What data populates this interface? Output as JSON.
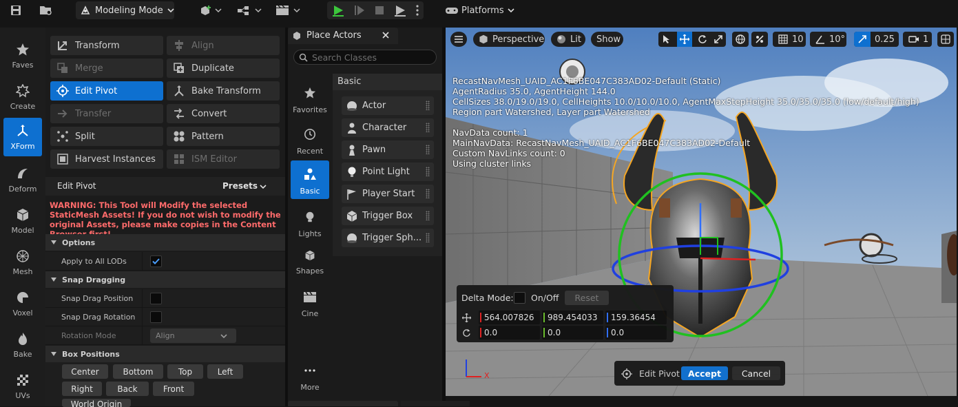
{
  "toolbar": {
    "mode_label": "Modeling Mode",
    "platforms_label": "Platforms"
  },
  "categories": [
    {
      "label": "Faves",
      "icon": "star-icon"
    },
    {
      "label": "Create",
      "icon": "create-icon"
    },
    {
      "label": "XForm",
      "icon": "xform-icon",
      "active": true
    },
    {
      "label": "Deform",
      "icon": "deform-icon"
    },
    {
      "label": "Model",
      "icon": "model-icon"
    },
    {
      "label": "Mesh",
      "icon": "mesh-icon"
    },
    {
      "label": "Voxel",
      "icon": "voxel-icon"
    },
    {
      "label": "Bake",
      "icon": "bake-icon"
    },
    {
      "label": "UVs",
      "icon": "uvs-icon"
    }
  ],
  "tools": {
    "transform": "Transform",
    "align": "Align",
    "merge": "Merge",
    "duplicate": "Duplicate",
    "edit_pivot": "Edit Pivot",
    "bake_transform": "Bake Transform",
    "transfer": "Transfer",
    "convert": "Convert",
    "split": "Split",
    "pattern": "Pattern",
    "harvest_instances": "Harvest Instances",
    "ism_editor": "ISM Editor"
  },
  "details": {
    "title": "Edit Pivot",
    "presets": "Presets",
    "warning": "WARNING: This Tool will Modify the selected StaticMesh Assets! If you do not wish to modify the original Assets, please make copies in the Content Browser first!",
    "options_header": "Options",
    "apply_all_lods": "Apply to All LODs",
    "apply_all_lods_checked": true,
    "snap_header": "Snap Dragging",
    "snap_drag_position": "Snap Drag Position",
    "snap_drag_rotation": "Snap Drag Rotation",
    "rotation_mode": "Rotation Mode",
    "rotation_mode_value": "Align",
    "box_header": "Box Positions",
    "box_buttons": [
      "Center",
      "Bottom",
      "Top",
      "Left",
      "Right",
      "Back",
      "Front"
    ],
    "world_origin": "World Origin"
  },
  "place_actors": {
    "tab_label": "Place Actors",
    "search_placeholder": "Search Classes",
    "section": "Basic",
    "categories": [
      {
        "label": "Favorites",
        "icon": "star-icon"
      },
      {
        "label": "Recent",
        "icon": "clock-icon"
      },
      {
        "label": "Basic",
        "icon": "basic-shapes-icon",
        "active": true
      },
      {
        "label": "Lights",
        "icon": "lightbulb-icon"
      },
      {
        "label": "Shapes",
        "icon": "cube-icon"
      },
      {
        "label": "Cine",
        "icon": "clapper-icon"
      },
      {
        "label": "More",
        "icon": "more-dots-icon"
      }
    ],
    "items": [
      "Actor",
      "Character",
      "Pawn",
      "Point Light",
      "Player Start",
      "Trigger Box",
      "Trigger Sph..."
    ]
  },
  "viewport": {
    "perspective": "Perspective",
    "lit": "Lit",
    "show": "Show",
    "grid_snap": "10",
    "rot_snap": "10°",
    "scale_snap": "0.25",
    "camera_speed": "1",
    "overlay_lines": [
      "RecastNavMesh_UAID_AC1F6BE047C383AD02-Default (Static)",
      "AgentRadius 35.0, AgentHeight 144.0",
      "CellSizes 38.0/19.0/19.0, CellHeights 10.0/10.0/10.0, AgentMaxStepHeight 35.0/35.0/35.0 (low/default/high)",
      "Region part Watershed, Layer part Watershed",
      "",
      "NavData count: 1",
      "MainNavData: RecastNavMesh_UAID_AC1F6BE047C383AD02-Default",
      "Custom NavLinks count: 0",
      "Using cluster links"
    ],
    "axis_x_label": "X"
  },
  "delta": {
    "label": "Delta Mode:",
    "onoff": "On/Off",
    "reset": "Reset",
    "loc_x": "564.007826",
    "loc_y": "989.454033",
    "loc_z": "159.36454",
    "rot_x": "0.0",
    "rot_y": "0.0",
    "rot_z": "0.0"
  },
  "accept_bar": {
    "tool_label": "Edit Pivot",
    "accept": "Accept",
    "cancel": "Cancel"
  },
  "colors": {
    "accent": "#0e70d0",
    "warning": "#ff6b6b",
    "selection_outline": "#f5a623",
    "axis_x": "#e02020",
    "axis_y": "#20c020",
    "axis_z": "#2040e0"
  }
}
